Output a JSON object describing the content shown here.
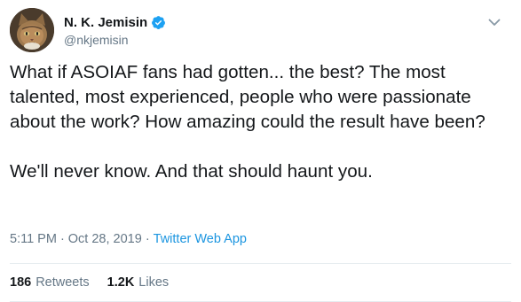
{
  "author": {
    "display_name": "N. K. Jemisin",
    "handle": "@nkjemisin",
    "verified": true,
    "avatar_icon": "cat-avatar"
  },
  "tweet": {
    "text": "What if ASOIAF fans had gotten... the best? The most talented, most experienced, people who were passionate about the work? How amazing could the result have been?\n\nWe'll never know. And that should haunt you.",
    "time": "5:11 PM",
    "date": "Oct 28, 2019",
    "separator": "·",
    "source": "Twitter Web App"
  },
  "stats": {
    "retweets_count": "186",
    "retweets_label": "Retweets",
    "likes_count": "1.2K",
    "likes_label": "Likes"
  },
  "colors": {
    "text": "#14171a",
    "secondary": "#657786",
    "link": "#1b95e0",
    "verified_badge": "#1da1f2",
    "divider": "#e6ecf0"
  },
  "icons": {
    "verified": "verified-badge-icon",
    "more": "chevron-down-icon"
  }
}
